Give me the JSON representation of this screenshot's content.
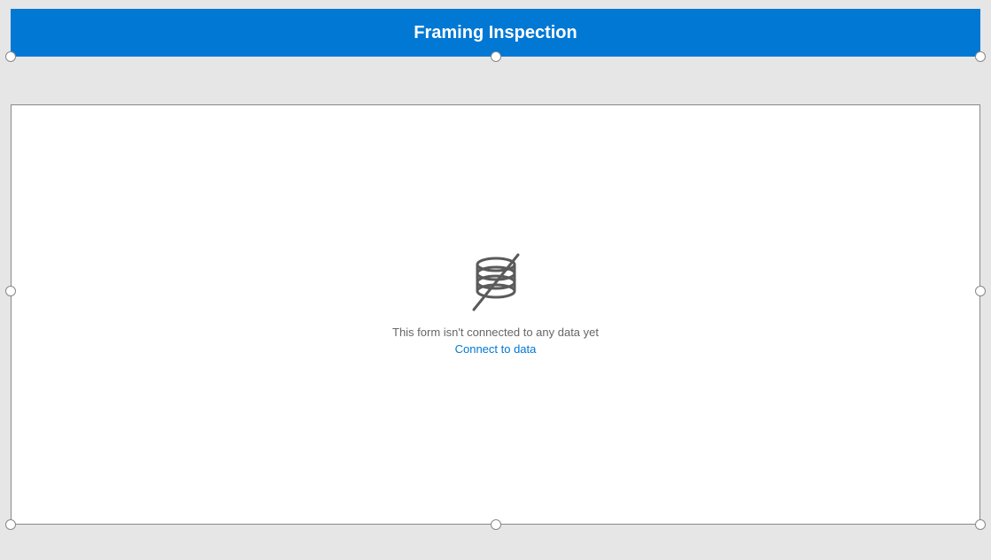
{
  "header": {
    "title": "Framing Inspection"
  },
  "emptyState": {
    "icon": "database-disconnected-icon",
    "message": "This form isn't connected to any data yet",
    "linkLabel": "Connect to data"
  },
  "colors": {
    "accent": "#0078d4",
    "canvasBg": "#e6e6e6",
    "formBg": "#ffffff",
    "mutedText": "#666666"
  }
}
